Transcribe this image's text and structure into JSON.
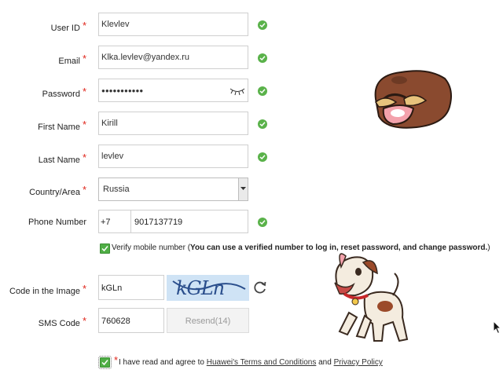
{
  "form": {
    "user_id": {
      "label": "User ID",
      "value": "Klevlev"
    },
    "email": {
      "label": "Email",
      "value": "Klka.levlev@yandex.ru"
    },
    "password": {
      "label": "Password",
      "value": "●●●●●●●●●●●"
    },
    "first_name": {
      "label": "First Name",
      "value": "Kirill"
    },
    "last_name": {
      "label": "Last Name",
      "value": "levlev"
    },
    "country": {
      "label": "Country/Area",
      "value": "Russia"
    },
    "phone": {
      "label": "Phone Number",
      "code": "+7",
      "value": "9017137719"
    },
    "verify_mobile": {
      "label": "Verify mobile number (",
      "bold": "You can use a verified number to log in, reset password, and change password.",
      "end": ")"
    },
    "captcha": {
      "label": "Code in the Image",
      "value": "kGLn",
      "image_text": "kGLn"
    },
    "sms": {
      "label": "SMS Code",
      "value": "760628",
      "resend": "Resend(14)"
    },
    "agree": {
      "prefix": "I have read and agree to",
      "terms": "Huawei's Terms and Conditions",
      "and": "and",
      "privacy": "Privacy Policy"
    },
    "required_mark": "*"
  },
  "colors": {
    "required": "#e0261c",
    "ok": "#5ab24a",
    "captcha_bg": "#cfe3f5"
  },
  "icons": [
    "check-circle-icon",
    "eye-closed-icon",
    "refresh-icon",
    "checkbox-icon",
    "mouse-cursor-icon",
    "dropdown-arrow-icon"
  ]
}
